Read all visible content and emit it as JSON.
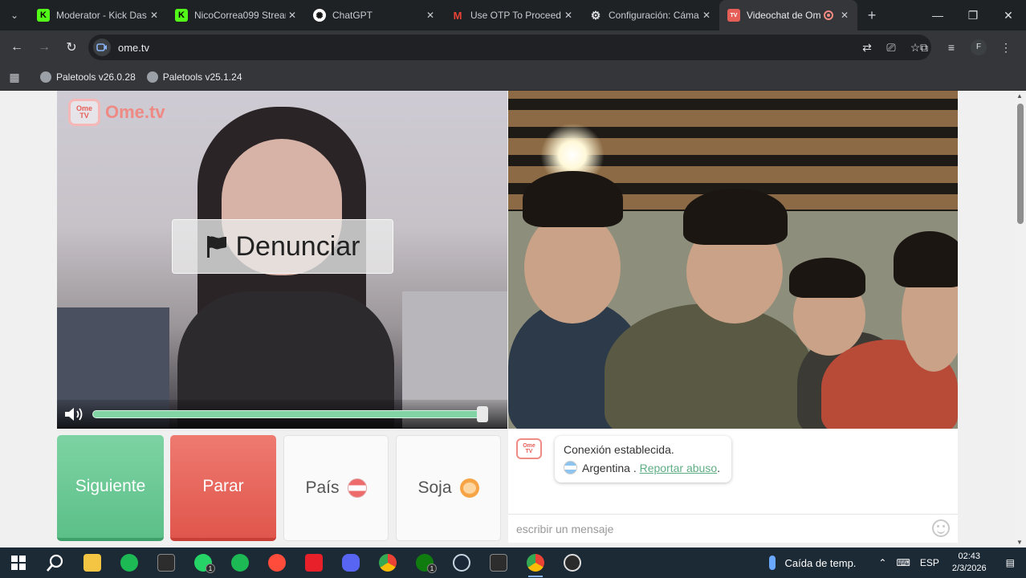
{
  "browser": {
    "tabs": [
      {
        "title": "Moderator - Kick Das",
        "favicon": "kick-icon",
        "color": "#53fc18"
      },
      {
        "title": "NicoCorrea099 Stream",
        "favicon": "kick-icon",
        "color": "#53fc18"
      },
      {
        "title": "ChatGPT",
        "favicon": "chatgpt-icon",
        "color": "#ffffff"
      },
      {
        "title": "Use OTP To Proceed",
        "favicon": "gmail-icon",
        "color": "#ea4335"
      },
      {
        "title": "Configuración: Cáma",
        "favicon": "gear-icon",
        "color": "#dfe1e5"
      },
      {
        "title": "Videochat de Om",
        "favicon": "ometv-icon",
        "color": "#e55e58",
        "active": true
      }
    ],
    "url": "ome.tv",
    "bookmarks": [
      {
        "label": "Paletools v26.0.28"
      },
      {
        "label": "Paletools v25.1.24"
      }
    ],
    "profile_initial": "F"
  },
  "site": {
    "logo_text": "Ome.tv",
    "logo_badge_top": "Ome",
    "logo_badge_bottom": "TV",
    "report_label": "Denunciar",
    "volume_level": 0.97,
    "buttons": {
      "next": "Siguiente",
      "stop": "Parar",
      "country": "País",
      "gender": "Soja"
    },
    "chat": {
      "connected": "Conexión establecida.",
      "country": "Argentina",
      "separator": " . ",
      "report_abuse": "Reportar abuso",
      "report_suffix": ".",
      "input_placeholder": "escribir un mensaje"
    }
  },
  "taskbar": {
    "weather": "Caída de temp.",
    "language": "ESP",
    "time": "02:43",
    "date": "2/3/2026",
    "whatsapp_badge": "1",
    "xbox_badge": "1"
  },
  "colors": {
    "next": "#6fcb96",
    "stop": "#e6645a",
    "accent_green": "#5fae83"
  }
}
